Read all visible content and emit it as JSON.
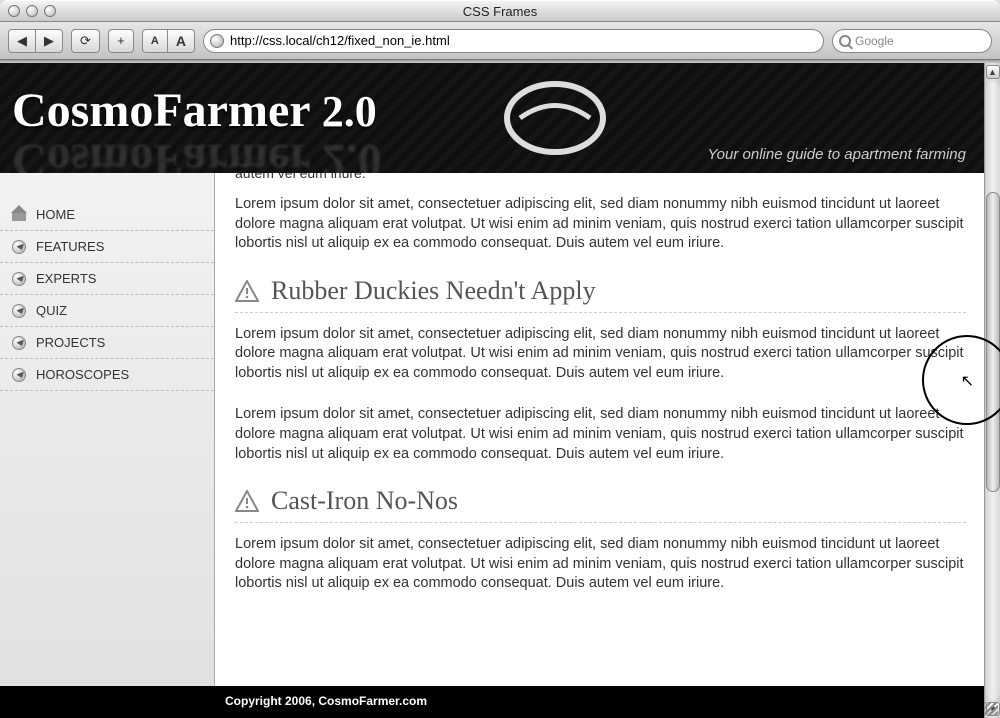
{
  "window": {
    "title": "CSS Frames"
  },
  "toolbar": {
    "back": "◀",
    "forward": "▶",
    "reload": "⟳",
    "add": "+",
    "text_small": "A",
    "text_large": "A",
    "url": "http://css.local/ch12/fixed_non_ie.html",
    "search_placeholder": "Google",
    "search_prefix": "Q▾"
  },
  "banner": {
    "brand": "CosmoFarmer",
    "version": "2.0",
    "tagline": "Your online guide to apartment farming"
  },
  "sidebar": {
    "items": [
      {
        "label": "HOME"
      },
      {
        "label": "FEATURES"
      },
      {
        "label": "EXPERTS"
      },
      {
        "label": "QUIZ"
      },
      {
        "label": "PROJECTS"
      },
      {
        "label": "HOROSCOPES"
      }
    ]
  },
  "article": {
    "partial_top": "autem vel eum iriure.",
    "para": "Lorem ipsum dolor sit amet, consectetuer adipiscing elit, sed diam nonummy nibh euismod tincidunt ut laoreet dolore magna aliquam erat volutpat. Ut wisi enim ad minim veniam, quis nostrud exerci tation ullamcorper suscipit lobortis nisl ut aliquip ex ea commodo consequat. Duis autem vel eum iriure.",
    "h1": "Rubber Duckies Needn't Apply",
    "h2": "Cast-Iron No-Nos"
  },
  "footer": {
    "text": "Copyright 2006, CosmoFarmer.com"
  }
}
